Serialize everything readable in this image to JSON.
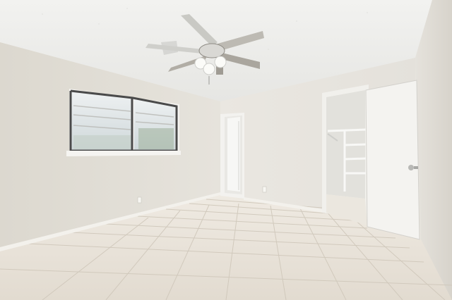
{
  "scene": {
    "kind": "empty bedroom interior photo",
    "colors": {
      "ceiling": "#eeeeec",
      "wall_left": "#e4e0d8",
      "wall_back": "#e9e6e0",
      "wall_right": "#e3e0da",
      "floor_tile": "#e8e2d8",
      "grout": "#cfc7ba",
      "door": "#f3f2ef",
      "window_sky": "#dfe6ea"
    },
    "elements": [
      "ceiling-fan",
      "window",
      "hallway-doorway",
      "closet-doorway",
      "closet-shelving",
      "open-door",
      "tile-floor",
      "baseboards",
      "outlets"
    ]
  }
}
